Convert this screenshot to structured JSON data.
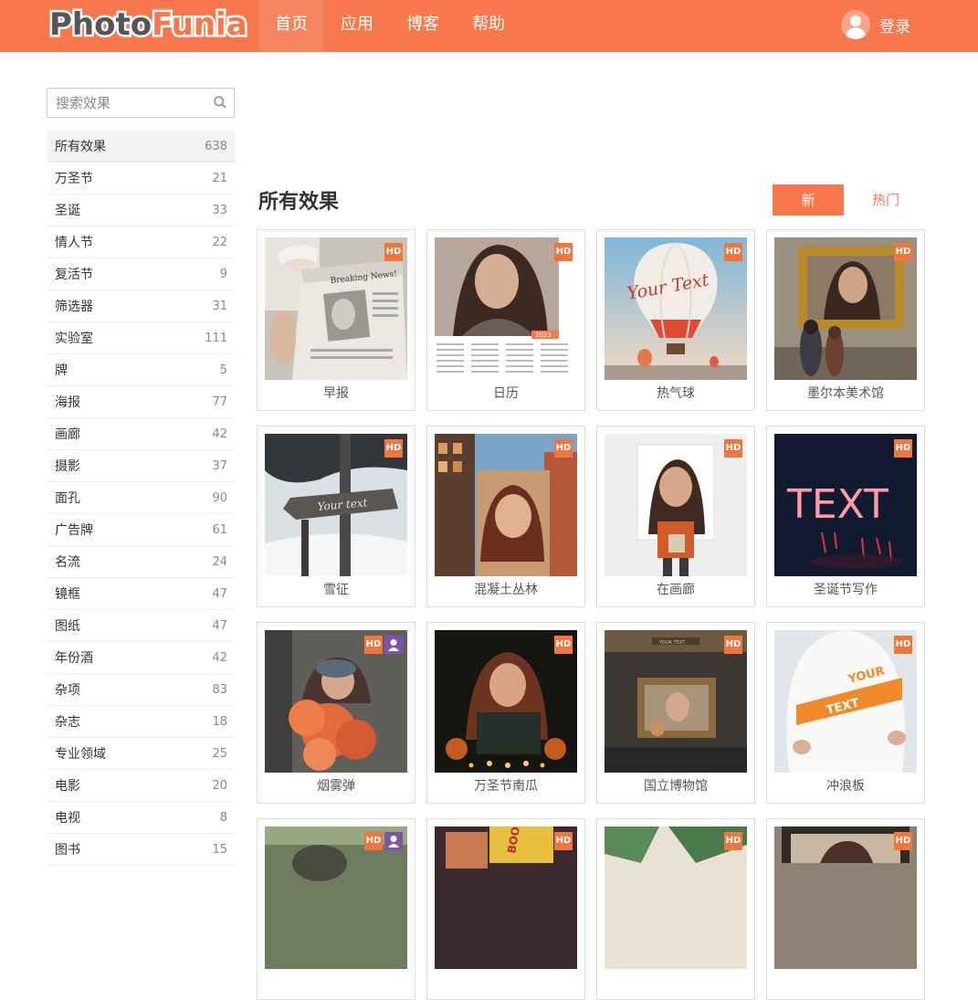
{
  "header": {
    "logo_part1": "Photo",
    "logo_part2": "Funia",
    "nav": [
      "首页",
      "应用",
      "博客",
      "帮助"
    ],
    "login": "登录",
    "brand_color": "#f9774d"
  },
  "search": {
    "placeholder": "搜索效果",
    "icon": "search-icon"
  },
  "categories": [
    {
      "name": "所有效果",
      "count": "638"
    },
    {
      "name": "万圣节",
      "count": "21"
    },
    {
      "name": "圣诞",
      "count": "33"
    },
    {
      "name": "情人节",
      "count": "22"
    },
    {
      "name": "复活节",
      "count": "9"
    },
    {
      "name": "筛选器",
      "count": "31"
    },
    {
      "name": "实验室",
      "count": "111"
    },
    {
      "name": "牌",
      "count": "5"
    },
    {
      "name": "海报",
      "count": "77"
    },
    {
      "name": "画廊",
      "count": "42"
    },
    {
      "name": "摄影",
      "count": "37"
    },
    {
      "name": "面孔",
      "count": "90"
    },
    {
      "name": "广告牌",
      "count": "61"
    },
    {
      "name": "名流",
      "count": "24"
    },
    {
      "name": "镜框",
      "count": "47"
    },
    {
      "name": "图纸",
      "count": "47"
    },
    {
      "name": "年份酒",
      "count": "42"
    },
    {
      "name": "杂项",
      "count": "83"
    },
    {
      "name": "杂志",
      "count": "18"
    },
    {
      "name": "专业领域",
      "count": "25"
    },
    {
      "name": "电影",
      "count": "20"
    },
    {
      "name": "电视",
      "count": "8"
    },
    {
      "name": "图书",
      "count": "15"
    }
  ],
  "main": {
    "title": "所有效果",
    "btn_new": "新",
    "btn_hot": "热门",
    "badge_hd": "HD",
    "effects": [
      {
        "label": "早报",
        "badges": [
          "hd"
        ]
      },
      {
        "label": "日历",
        "badges": [
          "hd"
        ]
      },
      {
        "label": "热气球",
        "badges": [
          "hd"
        ]
      },
      {
        "label": "墨尔本美术馆",
        "badges": [
          "hd"
        ]
      },
      {
        "label": "雪征",
        "badges": [
          "hd"
        ]
      },
      {
        "label": "混凝土丛林",
        "badges": [
          "hd"
        ]
      },
      {
        "label": "在画廊",
        "badges": [
          "hd"
        ]
      },
      {
        "label": "圣诞节写作",
        "badges": [
          "hd"
        ]
      },
      {
        "label": "烟雾弹",
        "badges": [
          "hd",
          "user"
        ]
      },
      {
        "label": "万圣节南瓜",
        "badges": [
          "hd"
        ]
      },
      {
        "label": "国立博物馆",
        "badges": [
          "hd"
        ]
      },
      {
        "label": "冲浪板",
        "badges": [
          "hd"
        ]
      },
      {
        "label": "",
        "badges": [
          "hd",
          "user"
        ]
      },
      {
        "label": "",
        "badges": [
          "hd"
        ]
      },
      {
        "label": "",
        "badges": [
          "hd"
        ]
      },
      {
        "label": "",
        "badges": [
          "hd"
        ]
      }
    ]
  },
  "thumb_text": {
    "newspaper": "Breaking News!",
    "calendar_year": "2023",
    "balloon": "Your Text",
    "snow_sign": "Your text",
    "neon": "TEXT",
    "surf1": "YOUR",
    "surf2": "TEXT",
    "museum_plate": "YOUR TEXT",
    "poster": "BOOK"
  }
}
